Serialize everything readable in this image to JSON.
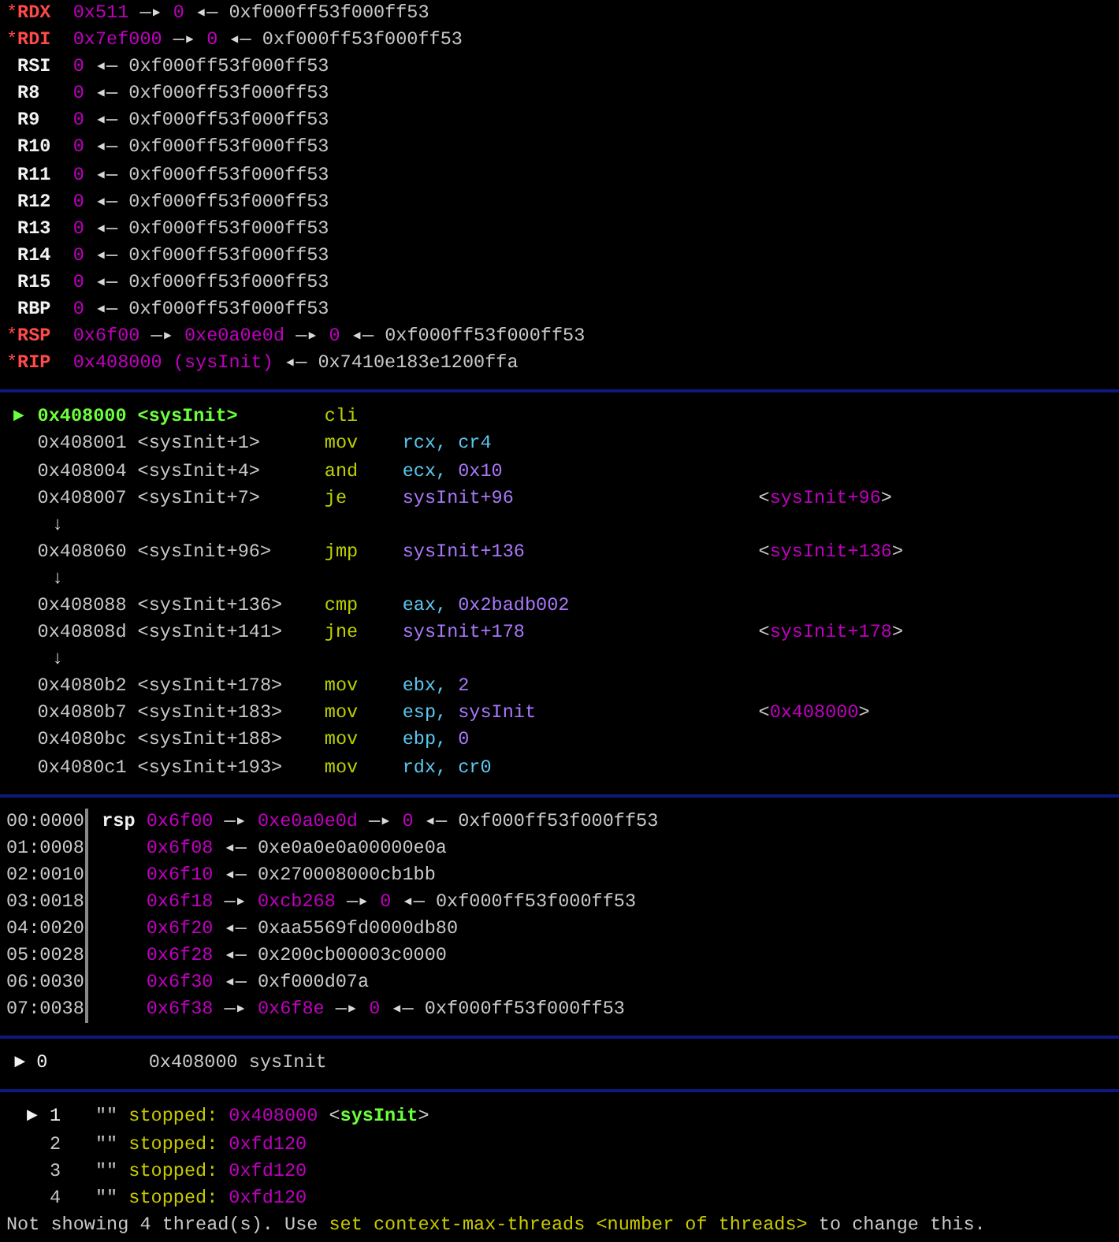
{
  "registers": [
    {
      "marker": "*",
      "name": "RDX",
      "changed": true,
      "chain": [
        {
          "text": "0x511",
          "kind": "pointer"
        },
        {
          "text": "—▸",
          "kind": "arrow"
        },
        {
          "text": "0",
          "kind": "pointer"
        },
        {
          "text": "◂—",
          "kind": "arrow"
        },
        {
          "text": "0xf000ff53f000ff53",
          "kind": "data"
        }
      ]
    },
    {
      "marker": "*",
      "name": "RDI",
      "changed": true,
      "chain": [
        {
          "text": "0x7ef000",
          "kind": "pointer"
        },
        {
          "text": "—▸",
          "kind": "arrow"
        },
        {
          "text": "0",
          "kind": "pointer"
        },
        {
          "text": "◂—",
          "kind": "arrow"
        },
        {
          "text": "0xf000ff53f000ff53",
          "kind": "data"
        }
      ]
    },
    {
      "name": "RSI",
      "changed": false,
      "chain": [
        {
          "text": "0",
          "kind": "pointer"
        },
        {
          "text": "◂—",
          "kind": "arrow"
        },
        {
          "text": "0xf000ff53f000ff53",
          "kind": "data"
        }
      ]
    },
    {
      "name": "R8",
      "changed": false,
      "chain": [
        {
          "text": "0",
          "kind": "pointer"
        },
        {
          "text": "◂—",
          "kind": "arrow"
        },
        {
          "text": "0xf000ff53f000ff53",
          "kind": "data"
        }
      ]
    },
    {
      "name": "R9",
      "changed": false,
      "chain": [
        {
          "text": "0",
          "kind": "pointer"
        },
        {
          "text": "◂—",
          "kind": "arrow"
        },
        {
          "text": "0xf000ff53f000ff53",
          "kind": "data"
        }
      ]
    },
    {
      "name": "R10",
      "changed": false,
      "chain": [
        {
          "text": "0",
          "kind": "pointer"
        },
        {
          "text": "◂—",
          "kind": "arrow"
        },
        {
          "text": "0xf000ff53f000ff53",
          "kind": "data"
        }
      ]
    },
    {
      "name": "R11",
      "changed": false,
      "chain": [
        {
          "text": "0",
          "kind": "pointer"
        },
        {
          "text": "◂—",
          "kind": "arrow"
        },
        {
          "text": "0xf000ff53f000ff53",
          "kind": "data"
        }
      ]
    },
    {
      "name": "R12",
      "changed": false,
      "chain": [
        {
          "text": "0",
          "kind": "pointer"
        },
        {
          "text": "◂—",
          "kind": "arrow"
        },
        {
          "text": "0xf000ff53f000ff53",
          "kind": "data"
        }
      ]
    },
    {
      "name": "R13",
      "changed": false,
      "chain": [
        {
          "text": "0",
          "kind": "pointer"
        },
        {
          "text": "◂—",
          "kind": "arrow"
        },
        {
          "text": "0xf000ff53f000ff53",
          "kind": "data"
        }
      ]
    },
    {
      "name": "R14",
      "changed": false,
      "chain": [
        {
          "text": "0",
          "kind": "pointer"
        },
        {
          "text": "◂—",
          "kind": "arrow"
        },
        {
          "text": "0xf000ff53f000ff53",
          "kind": "data"
        }
      ]
    },
    {
      "name": "R15",
      "changed": false,
      "chain": [
        {
          "text": "0",
          "kind": "pointer"
        },
        {
          "text": "◂—",
          "kind": "arrow"
        },
        {
          "text": "0xf000ff53f000ff53",
          "kind": "data"
        }
      ]
    },
    {
      "name": "RBP",
      "changed": false,
      "chain": [
        {
          "text": "0",
          "kind": "pointer"
        },
        {
          "text": "◂—",
          "kind": "arrow"
        },
        {
          "text": "0xf000ff53f000ff53",
          "kind": "data"
        }
      ]
    },
    {
      "marker": "*",
      "name": "RSP",
      "changed": true,
      "chain": [
        {
          "text": "0x6f00",
          "kind": "pointer"
        },
        {
          "text": "—▸",
          "kind": "arrow"
        },
        {
          "text": "0xe0a0e0d",
          "kind": "pointer"
        },
        {
          "text": "—▸",
          "kind": "arrow"
        },
        {
          "text": "0",
          "kind": "pointer"
        },
        {
          "text": "◂—",
          "kind": "arrow"
        },
        {
          "text": "0xf000ff53f000ff53",
          "kind": "data"
        }
      ]
    },
    {
      "marker": "*",
      "name": "RIP",
      "changed": true,
      "chain": [
        {
          "text": "0x408000 (sysInit)",
          "kind": "pointer"
        },
        {
          "text": "◂—",
          "kind": "arrow"
        },
        {
          "text": "0x7410e183e1200ffa",
          "kind": "data"
        }
      ]
    }
  ],
  "disasm": [
    {
      "kind": "instruction",
      "current": true,
      "marker": "►",
      "address": "0x408000",
      "symbol": "<sysInit>",
      "mnemonic": "cli"
    },
    {
      "kind": "instruction",
      "current": false,
      "address": "0x408001",
      "symbol": "<sysInit+1>",
      "mnemonic": "mov",
      "operands": [
        {
          "text": "rcx,",
          "kind": "register"
        },
        {
          "text": "cr4",
          "kind": "register"
        }
      ]
    },
    {
      "kind": "instruction",
      "current": false,
      "address": "0x408004",
      "symbol": "<sysInit+4>",
      "mnemonic": "and",
      "operands": [
        {
          "text": "ecx,",
          "kind": "register"
        },
        {
          "text": "0x10",
          "kind": "immediate"
        }
      ]
    },
    {
      "kind": "instruction",
      "current": false,
      "address": "0x408007",
      "symbol": "<sysInit+7>",
      "mnemonic": "je",
      "operands": [
        {
          "text": "sysInit+96",
          "kind": "immediate"
        }
      ],
      "comment": {
        "open": "<",
        "text": "sysInit+96",
        "close": ">"
      }
    },
    {
      "kind": "branch",
      "text": "↓"
    },
    {
      "kind": "instruction",
      "current": false,
      "address": "0x408060",
      "symbol": "<sysInit+96>",
      "mnemonic": "jmp",
      "operands": [
        {
          "text": "sysInit+136",
          "kind": "immediate"
        }
      ],
      "comment": {
        "open": "<",
        "text": "sysInit+136",
        "close": ">"
      }
    },
    {
      "kind": "branch",
      "text": "↓"
    },
    {
      "kind": "instruction",
      "current": false,
      "address": "0x408088",
      "symbol": "<sysInit+136>",
      "mnemonic": "cmp",
      "operands": [
        {
          "text": "eax,",
          "kind": "register"
        },
        {
          "text": "0x2badb002",
          "kind": "immediate"
        }
      ]
    },
    {
      "kind": "instruction",
      "current": false,
      "address": "0x40808d",
      "symbol": "<sysInit+141>",
      "mnemonic": "jne",
      "operands": [
        {
          "text": "sysInit+178",
          "kind": "immediate"
        }
      ],
      "comment": {
        "open": "<",
        "text": "sysInit+178",
        "close": ">"
      }
    },
    {
      "kind": "branch",
      "text": "↓"
    },
    {
      "kind": "instruction",
      "current": false,
      "address": "0x4080b2",
      "symbol": "<sysInit+178>",
      "mnemonic": "mov",
      "operands": [
        {
          "text": "ebx,",
          "kind": "register"
        },
        {
          "text": "2",
          "kind": "immediate"
        }
      ]
    },
    {
      "kind": "instruction",
      "current": false,
      "address": "0x4080b7",
      "symbol": "<sysInit+183>",
      "mnemonic": "mov",
      "operands": [
        {
          "text": "esp,",
          "kind": "register"
        },
        {
          "text": "sysInit",
          "kind": "immediate"
        }
      ],
      "comment": {
        "open": "<",
        "text": "0x408000",
        "close": ">"
      }
    },
    {
      "kind": "instruction",
      "current": false,
      "address": "0x4080bc",
      "symbol": "<sysInit+188>",
      "mnemonic": "mov",
      "operands": [
        {
          "text": "ebp,",
          "kind": "register"
        },
        {
          "text": "0",
          "kind": "immediate"
        }
      ]
    },
    {
      "kind": "instruction",
      "current": false,
      "address": "0x4080c1",
      "symbol": "<sysInit+193>",
      "mnemonic": "mov",
      "operands": [
        {
          "text": "rdx,",
          "kind": "register"
        },
        {
          "text": "cr0",
          "kind": "register"
        }
      ]
    }
  ],
  "stack": [
    {
      "offset": "00:0000",
      "register": "rsp",
      "chain": [
        {
          "text": "0x6f00",
          "kind": "pointer"
        },
        {
          "text": "—▸",
          "kind": "arrow"
        },
        {
          "text": "0xe0a0e0d",
          "kind": "pointer"
        },
        {
          "text": "—▸",
          "kind": "arrow"
        },
        {
          "text": "0",
          "kind": "pointer"
        },
        {
          "text": "◂—",
          "kind": "arrow"
        },
        {
          "text": "0xf000ff53f000ff53",
          "kind": "data"
        }
      ]
    },
    {
      "offset": "01:0008",
      "chain": [
        {
          "text": "0x6f08",
          "kind": "pointer"
        },
        {
          "text": "◂—",
          "kind": "arrow"
        },
        {
          "text": "0xe0a0e0a00000e0a",
          "kind": "data"
        }
      ]
    },
    {
      "offset": "02:0010",
      "chain": [
        {
          "text": "0x6f10",
          "kind": "pointer"
        },
        {
          "text": "◂—",
          "kind": "arrow"
        },
        {
          "text": "0x270008000cb1bb",
          "kind": "data"
        }
      ]
    },
    {
      "offset": "03:0018",
      "chain": [
        {
          "text": "0x6f18",
          "kind": "pointer"
        },
        {
          "text": "—▸",
          "kind": "arrow"
        },
        {
          "text": "0xcb268",
          "kind": "pointer"
        },
        {
          "text": "—▸",
          "kind": "arrow"
        },
        {
          "text": "0",
          "kind": "pointer"
        },
        {
          "text": "◂—",
          "kind": "arrow"
        },
        {
          "text": "0xf000ff53f000ff53",
          "kind": "data"
        }
      ]
    },
    {
      "offset": "04:0020",
      "chain": [
        {
          "text": "0x6f20",
          "kind": "pointer"
        },
        {
          "text": "◂—",
          "kind": "arrow"
        },
        {
          "text": "0xaa5569fd0000db80",
          "kind": "data"
        }
      ]
    },
    {
      "offset": "05:0028",
      "chain": [
        {
          "text": "0x6f28",
          "kind": "pointer"
        },
        {
          "text": "◂—",
          "kind": "arrow"
        },
        {
          "text": "0x200cb00003c0000",
          "kind": "data"
        }
      ]
    },
    {
      "offset": "06:0030",
      "chain": [
        {
          "text": "0x6f30",
          "kind": "pointer"
        },
        {
          "text": "◂—",
          "kind": "arrow"
        },
        {
          "text": "0xf000d07a",
          "kind": "data"
        }
      ]
    },
    {
      "offset": "07:0038",
      "chain": [
        {
          "text": "0x6f38",
          "kind": "pointer"
        },
        {
          "text": "—▸",
          "kind": "arrow"
        },
        {
          "text": "0x6f8e",
          "kind": "pointer"
        },
        {
          "text": "—▸",
          "kind": "arrow"
        },
        {
          "text": "0",
          "kind": "pointer"
        },
        {
          "text": "◂—",
          "kind": "arrow"
        },
        {
          "text": "0xf000ff53f000ff53",
          "kind": "data"
        }
      ]
    }
  ],
  "backtrace": [
    {
      "selected": true,
      "marker": "►",
      "index": "0",
      "address": "0x408000",
      "symbol": "sysInit"
    }
  ],
  "threads": [
    {
      "selected": true,
      "marker": "►",
      "id": "1",
      "name": "\"\"",
      "state": "stopped:",
      "address": "0x408000",
      "symbol": {
        "open": "<",
        "text": "sysInit",
        "close": ">"
      }
    },
    {
      "selected": false,
      "id": "2",
      "name": "\"\"",
      "state": "stopped:",
      "address": "0xfd120"
    },
    {
      "selected": false,
      "id": "3",
      "name": "\"\"",
      "state": "stopped:",
      "address": "0xfd120"
    },
    {
      "selected": false,
      "id": "4",
      "name": "\"\"",
      "state": "stopped:",
      "address": "0xfd120"
    }
  ],
  "footer": [
    {
      "text": "Not showing 4 thread(s). Use",
      "kind": "plain"
    },
    {
      "text": "set context-max-threads <number of threads>",
      "kind": "command"
    },
    {
      "text": "to change this.",
      "kind": "plain"
    }
  ]
}
